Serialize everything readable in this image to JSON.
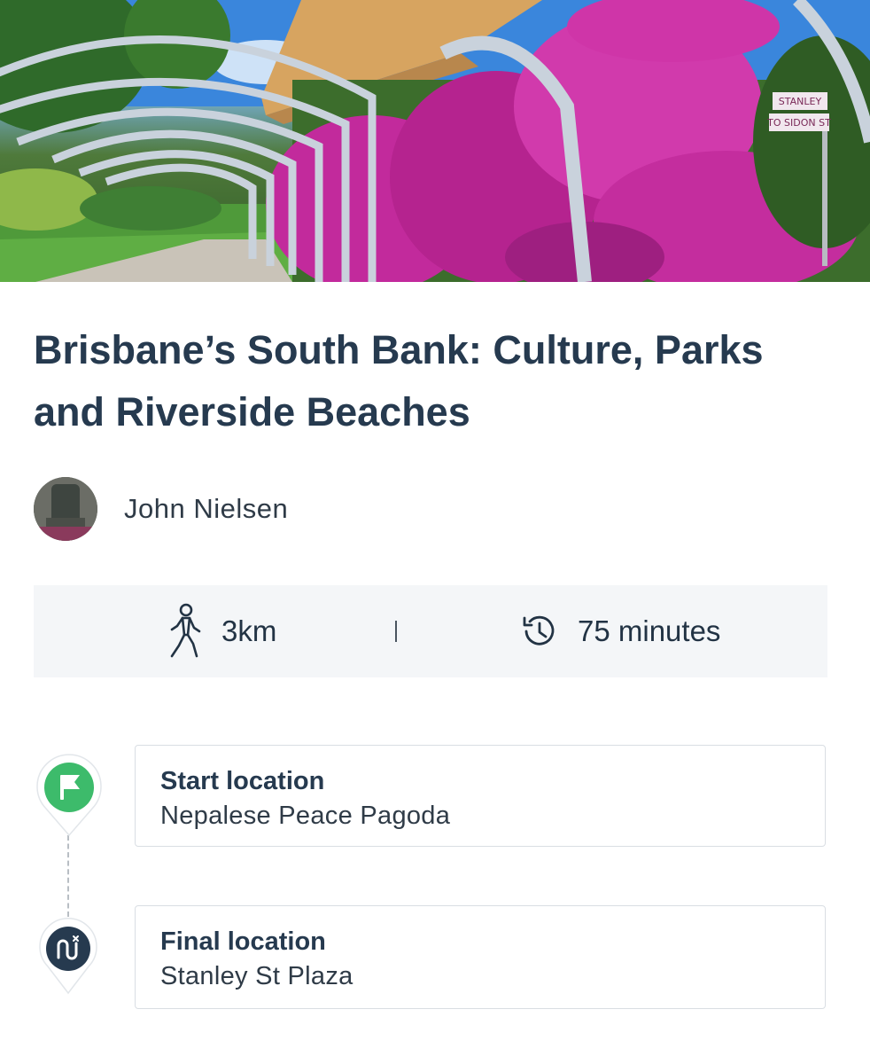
{
  "hero": {
    "icon": "hero-photo"
  },
  "route": {
    "title": "Brisbane’s South Bank: Culture, Parks and Riverside Beaches",
    "author": "John Nielsen"
  },
  "stats": {
    "distance": "3km",
    "duration": "75 minutes"
  },
  "locations": {
    "start": {
      "label": "Start location",
      "value": "Nepalese Peace Pagoda"
    },
    "final": {
      "label": "Final location",
      "value": "Stanley St Plaza"
    }
  },
  "sign": {
    "line1": "STANLEY",
    "line2": "TO SIDON ST"
  },
  "colors": {
    "accent_green": "#3dbb6b",
    "dark_navy": "#263a4f",
    "stats_bg": "#f4f6f8",
    "bougainvillea": "#c8289f"
  }
}
